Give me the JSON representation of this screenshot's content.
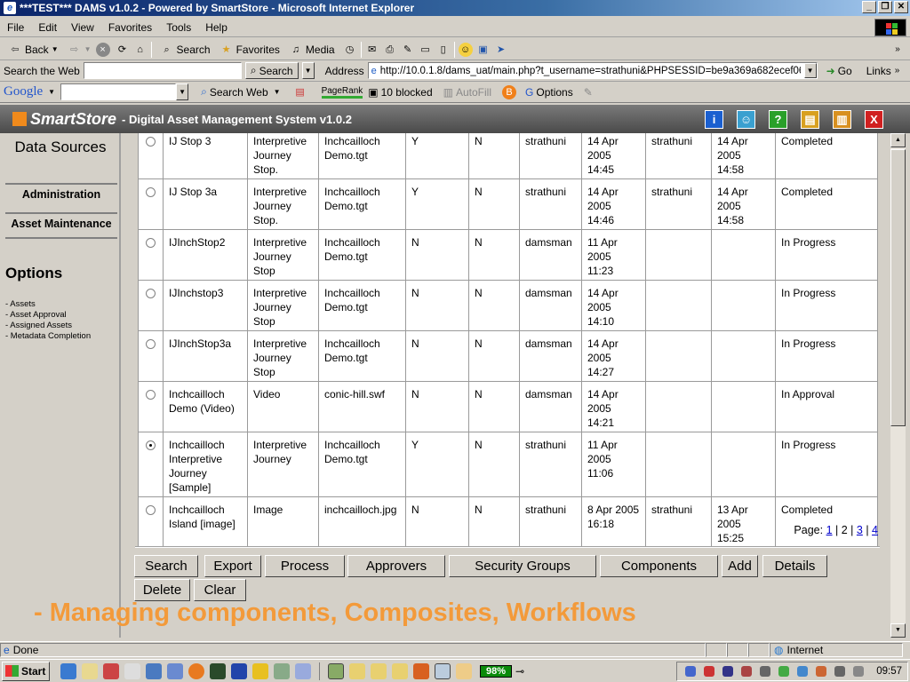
{
  "window": {
    "title": "***TEST*** DAMS v1.0.2 - Powered by SmartStore - Microsoft Internet Explorer",
    "min": "_",
    "max": "❐",
    "close": "✕"
  },
  "menu": [
    "File",
    "Edit",
    "View",
    "Favorites",
    "Tools",
    "Help"
  ],
  "toolbar": {
    "back": "Back",
    "search": "Search",
    "favorites": "Favorites",
    "media": "Media"
  },
  "addressbar": {
    "search_web_label": "Search the Web",
    "search_btn": "Search",
    "address_label": "Address",
    "url": "http://10.0.1.8/dams_uat/main.php?t_username=strathuni&PHPSESSID=be9a369a682ecef06c1698",
    "go": "Go",
    "links": "Links"
  },
  "googlebar": {
    "logo": "Google",
    "search_web": "Search Web",
    "pagerank": "PageRank",
    "blocked": "10 blocked",
    "autofill": "AutoFill",
    "options": "Options"
  },
  "app": {
    "logo": "SmartStore",
    "title": "- Digital Asset Management System v1.0.2",
    "icons": [
      {
        "name": "info-icon",
        "glyph": "i",
        "color": "#1a5fd0"
      },
      {
        "name": "user-icon",
        "glyph": "☺",
        "color": "#3aa0d0"
      },
      {
        "name": "help-icon",
        "glyph": "?",
        "color": "#2aa02a"
      },
      {
        "name": "folder-icon",
        "glyph": "▤",
        "color": "#d8a020"
      },
      {
        "name": "book-icon",
        "glyph": "▥",
        "color": "#d89020"
      },
      {
        "name": "close-icon",
        "glyph": "X",
        "color": "#d02020"
      }
    ]
  },
  "nav": {
    "data_sources": "Data Sources",
    "administration": "Administration",
    "asset_maintenance": "Asset Maintenance",
    "options_heading": "Options",
    "options": [
      "- Assets",
      "- Asset Approval",
      "- Assigned Assets",
      "- Metadata Completion"
    ]
  },
  "table": {
    "rows": [
      {
        "selected": false,
        "name": "IJ Stop 3",
        "type": "Interpretive Journey Stop.",
        "file": "Inchcailloch Demo.tgt",
        "c1": "Y",
        "c2": "N",
        "owner": "strathuni",
        "created": "14 Apr 2005 14:45",
        "approver": "strathuni",
        "approved": "14 Apr 2005 14:58",
        "status": "Completed"
      },
      {
        "selected": false,
        "name": "IJ Stop 3a",
        "type": "Interpretive Journey Stop.",
        "file": "Inchcailloch Demo.tgt",
        "c1": "Y",
        "c2": "N",
        "owner": "strathuni",
        "created": "14 Apr 2005 14:46",
        "approver": "strathuni",
        "approved": "14 Apr 2005 14:58",
        "status": "Completed"
      },
      {
        "selected": false,
        "name": "IJInchStop2",
        "type": "Interpretive Journey Stop",
        "file": "Inchcailloch Demo.tgt",
        "c1": "N",
        "c2": "N",
        "owner": "damsman",
        "created": "11 Apr 2005 11:23",
        "approver": "",
        "approved": "",
        "status": "In Progress"
      },
      {
        "selected": false,
        "name": "IJInchstop3",
        "type": "Interpretive Journey Stop",
        "file": "Inchcailloch Demo.tgt",
        "c1": "N",
        "c2": "N",
        "owner": "damsman",
        "created": "14 Apr 2005 14:10",
        "approver": "",
        "approved": "",
        "status": "In Progress"
      },
      {
        "selected": false,
        "name": "IJInchStop3a",
        "type": "Interpretive Journey Stop",
        "file": "Inchcailloch Demo.tgt",
        "c1": "N",
        "c2": "N",
        "owner": "damsman",
        "created": "14 Apr 2005 14:27",
        "approver": "",
        "approved": "",
        "status": "In Progress"
      },
      {
        "selected": false,
        "name": "Inchcailloch Demo (Video)",
        "type": "Video",
        "file": "conic-hill.swf",
        "c1": "N",
        "c2": "N",
        "owner": "damsman",
        "created": "14 Apr 2005 14:21",
        "approver": "",
        "approved": "",
        "status": "In Approval"
      },
      {
        "selected": true,
        "name": "Inchcailloch Interpretive Journey [Sample]",
        "type": "Interpretive Journey",
        "file": "Inchcailloch Demo.tgt",
        "c1": "Y",
        "c2": "N",
        "owner": "strathuni",
        "created": "11 Apr 2005 11:06",
        "approver": "",
        "approved": "",
        "status": "In Progress"
      },
      {
        "selected": false,
        "name": "Inchcailloch Island [image]",
        "type": "Image",
        "file": "inchcailloch.jpg",
        "c1": "N",
        "c2": "N",
        "owner": "strathuni",
        "created": "8 Apr 2005 16:18",
        "approver": "strathuni",
        "approved": "13 Apr 2005 15:25",
        "status": "Completed"
      }
    ]
  },
  "pager": {
    "label": "Page:",
    "pages": [
      "1",
      "2",
      "3",
      "4"
    ],
    "current": "2"
  },
  "actions": [
    "Search",
    "Export",
    "Process",
    "Approvers",
    "Security Groups",
    "Components",
    "Add",
    "Details",
    "Delete",
    "Clear"
  ],
  "caption": "- Managing components, Composites, Workflows",
  "status": {
    "text": "Done",
    "zone": "Internet"
  },
  "taskbar": {
    "start": "Start",
    "battery": "98%",
    "clock": "09:57"
  }
}
